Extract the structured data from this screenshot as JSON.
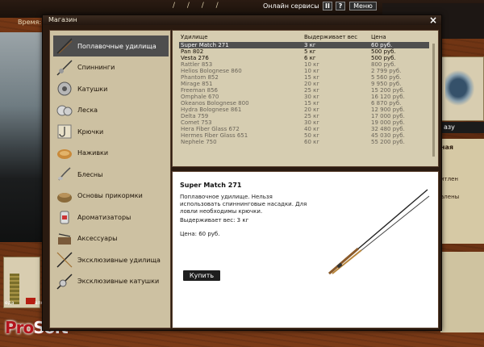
{
  "game_bar": {
    "time_label": "Время:",
    "online_services": "Онлайн сервисы",
    "pause": "II",
    "help": "?",
    "menu": "Меню"
  },
  "side": {
    "go_button": "азу",
    "note_title": "ная",
    "note_a": "итлен",
    "note_b": "алены"
  },
  "gauges": {
    "left_label": "еда",
    "right_label": "алк",
    "left_level": 0.85,
    "right_level": 0.2
  },
  "logo": {
    "pro": "Pro",
    "soft": "Soft"
  },
  "dialog": {
    "title": "Магазин",
    "close": "×",
    "categories": [
      {
        "label": "Поплавочные удилища",
        "icon": "float-rod-icon",
        "active": true
      },
      {
        "label": "Спиннинги",
        "icon": "spinning-rod-icon"
      },
      {
        "label": "Катушки",
        "icon": "reel-icon"
      },
      {
        "label": "Леска",
        "icon": "fishing-line-icon"
      },
      {
        "label": "Крючки",
        "icon": "hook-icon"
      },
      {
        "label": "Наживки",
        "icon": "bait-icon"
      },
      {
        "label": "Блесны",
        "icon": "spoon-lure-icon"
      },
      {
        "label": "Основы прикормки",
        "icon": "groundbait-icon"
      },
      {
        "label": "Ароматизаторы",
        "icon": "flavoring-icon"
      },
      {
        "label": "Аксессуары",
        "icon": "accessories-icon"
      },
      {
        "label": "Эксклюзивные удилища",
        "icon": "exclusive-rod-icon"
      },
      {
        "label": "Эксклюзивные катушки",
        "icon": "exclusive-reel-icon"
      }
    ],
    "list": {
      "headers": {
        "name": "Удилище",
        "weight": "Выдерживает вес",
        "price": "Цена"
      },
      "rows": [
        {
          "name": "Super Match 271",
          "weight": "3 кг",
          "price": "60 руб.",
          "selected": true,
          "available": true
        },
        {
          "name": "Pan 802",
          "weight": "5 кг",
          "price": "500 руб.",
          "available": true
        },
        {
          "name": "Vesta 276",
          "weight": "6 кг",
          "price": "500 руб.",
          "available": true
        },
        {
          "name": "Rattler 853",
          "weight": "10 кг",
          "price": "800 руб."
        },
        {
          "name": "Helios Bolognese 860",
          "weight": "10 кг",
          "price": "2 799 руб."
        },
        {
          "name": "Phantom 852",
          "weight": "15 кг",
          "price": "5 560 руб."
        },
        {
          "name": "Mirage 851",
          "weight": "20 кг",
          "price": "9 950 руб."
        },
        {
          "name": "Freeman 856",
          "weight": "25 кг",
          "price": "15 200 руб."
        },
        {
          "name": "Omphale 670",
          "weight": "30 кг",
          "price": "16 120 руб."
        },
        {
          "name": "Okeanos Bolognese 800",
          "weight": "15 кг",
          "price": "6 870 руб."
        },
        {
          "name": "Hydra Bolognese 861",
          "weight": "20 кг",
          "price": "12 900 руб."
        },
        {
          "name": "Delta 759",
          "weight": "25 кг",
          "price": "17 000 руб."
        },
        {
          "name": "Comet 753",
          "weight": "30 кг",
          "price": "19 000 руб."
        },
        {
          "name": "Hera Fiber Glass 672",
          "weight": "40 кг",
          "price": "32 480 руб."
        },
        {
          "name": "Hermes Fiber Glass 651",
          "weight": "50 кг",
          "price": "45 030 руб."
        },
        {
          "name": "Nephele 750",
          "weight": "60 кг",
          "price": "55 200 руб."
        }
      ]
    },
    "detail": {
      "title": "Super Match 271",
      "description": "Поплавочное удилище. Нельзя использовать спиннинговые насадки. Для ловли необходимы крючки.",
      "weight": "Выдерживает вес: 3 кг",
      "price": "Цена: 60 руб.",
      "buy": "Купить"
    }
  }
}
